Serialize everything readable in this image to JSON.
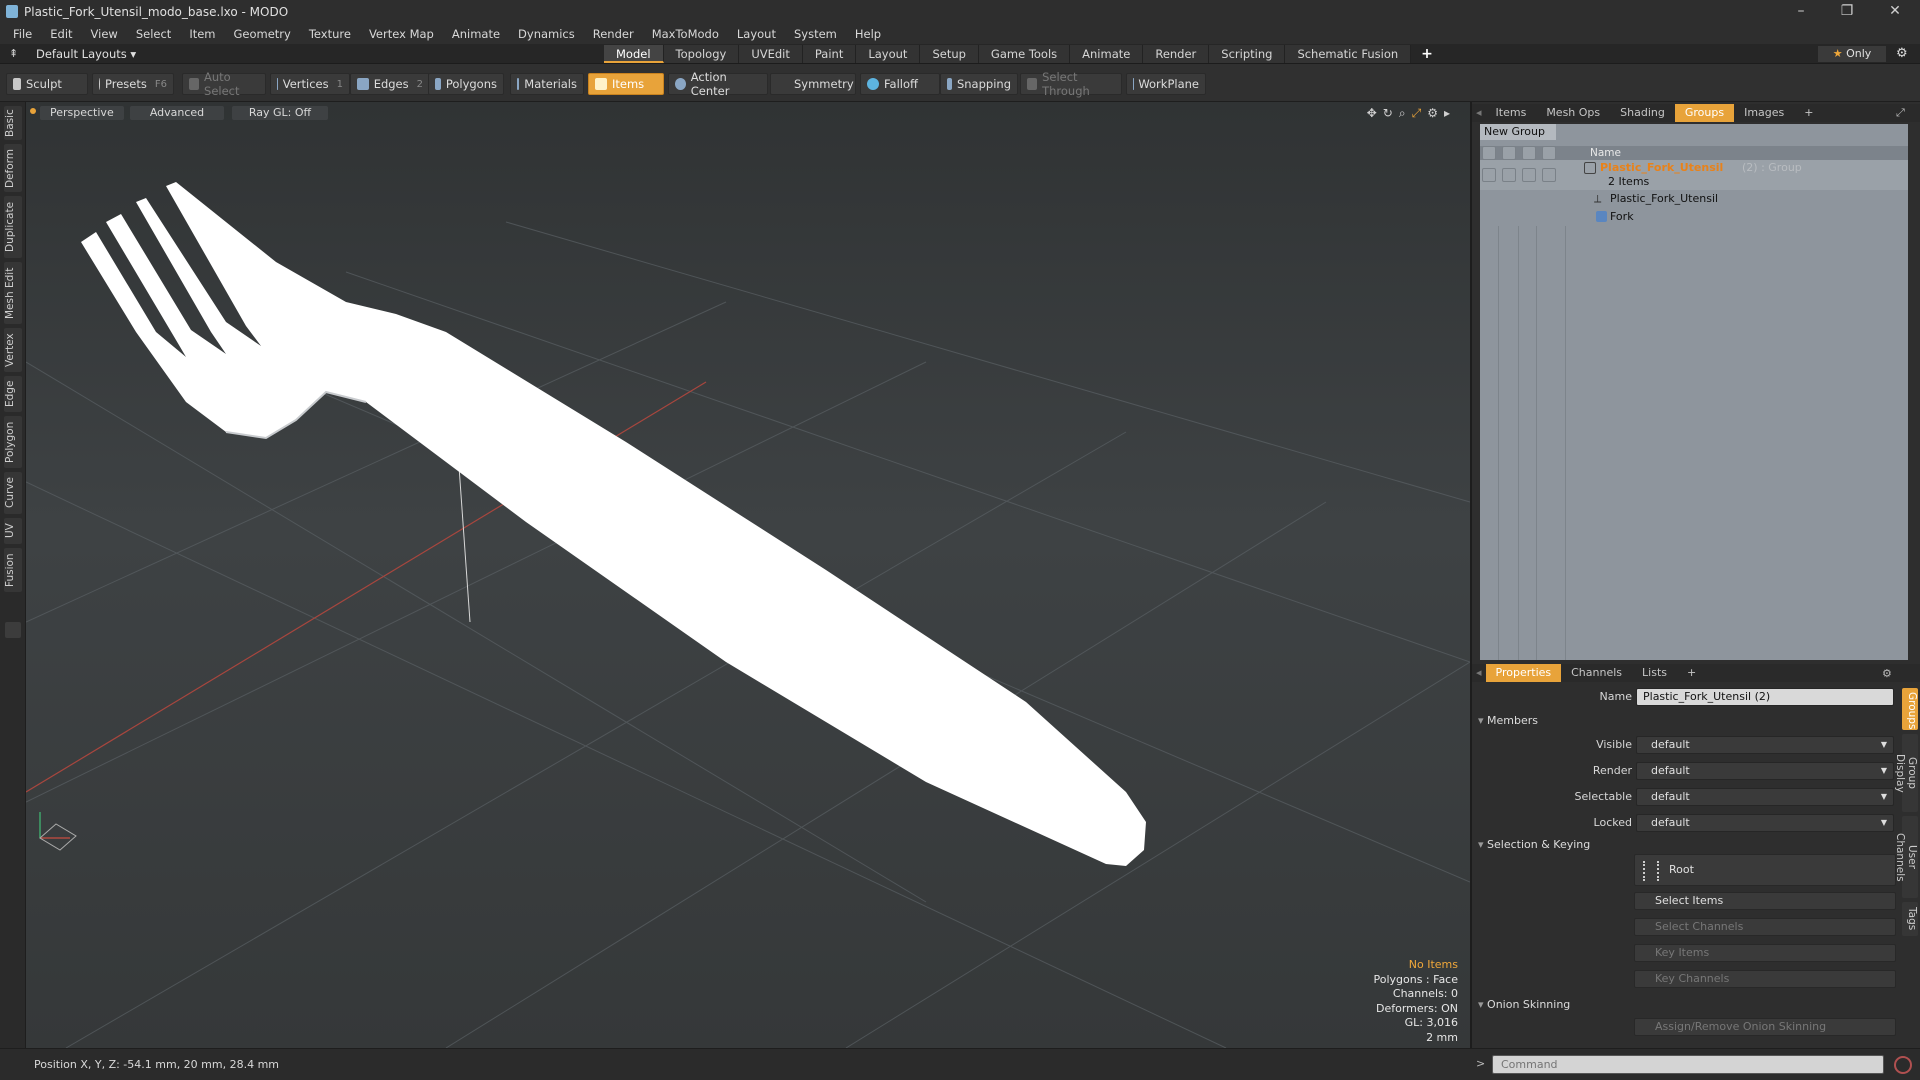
{
  "window": {
    "title": "Plastic_Fork_Utensil_modo_base.lxo - MODO",
    "min": "–",
    "max": "❐",
    "close": "✕"
  },
  "menu": [
    "File",
    "Edit",
    "View",
    "Select",
    "Item",
    "Geometry",
    "Texture",
    "Vertex Map",
    "Animate",
    "Dynamics",
    "Render",
    "MaxToModo",
    "Layout",
    "System",
    "Help"
  ],
  "layouts": {
    "label": "Default Layouts ▾",
    "tabs": [
      "Model",
      "Topology",
      "UVEdit",
      "Paint",
      "Layout",
      "Setup",
      "Game Tools",
      "Animate",
      "Render",
      "Scripting",
      "Schematic Fusion"
    ],
    "active": "Model",
    "plus": "+",
    "only": "Only",
    "only_star": "★"
  },
  "toolbar": {
    "sculpt": "Sculpt",
    "presets": "Presets",
    "presets_key": "F6",
    "auto_select": "Auto Select",
    "vertices": "Vertices",
    "vertices_key": "1",
    "edges": "Edges",
    "edges_key": "2",
    "polygons": "Polygons",
    "materials": "Materials",
    "items": "Items",
    "action_center": "Action Center",
    "symmetry": "Symmetry",
    "falloff": "Falloff",
    "snapping": "Snapping",
    "select_through": "Select Through",
    "workplane": "WorkPlane"
  },
  "left_tabs": [
    "Basic",
    "Deform",
    "Duplicate",
    "Mesh Edit",
    "Vertex",
    "Edge",
    "Polygon",
    "Curve",
    "UV",
    "Fusion"
  ],
  "viewport": {
    "perspective": "Perspective",
    "advanced": "Advanced",
    "raygl": "Ray GL: Off",
    "info": {
      "no_items": "No Items",
      "polygons": "Polygons : Face",
      "channels": "Channels: 0",
      "deformers": "Deformers: ON",
      "gl": "GL: 3,016",
      "scale": "2 mm"
    }
  },
  "panel_top": {
    "tabs": [
      "Items",
      "Mesh Ops",
      "Shading",
      "Groups",
      "Images"
    ],
    "active": "Groups",
    "plus": "+",
    "new_group": "New Group",
    "name_col": "Name",
    "group_name": "Plastic_Fork_Utensil",
    "group_suffix": "(2) : Group",
    "group_count": "2 Items",
    "children": [
      "Plastic_Fork_Utensil",
      "Fork"
    ]
  },
  "panel_bottom": {
    "tabs": [
      "Properties",
      "Channels",
      "Lists"
    ],
    "active": "Properties",
    "plus": "+",
    "name_label": "Name",
    "name_value": "Plastic_Fork_Utensil (2)",
    "members": "Members",
    "fields": [
      {
        "label": "Visible",
        "value": "default"
      },
      {
        "label": "Render",
        "value": "default"
      },
      {
        "label": "Selectable",
        "value": "default"
      },
      {
        "label": "Locked",
        "value": "default"
      }
    ],
    "sel_keying": "Selection & Keying",
    "root": "Root",
    "select_items": "Select Items",
    "select_channels": "Select Channels",
    "key_items": "Key Items",
    "key_channels": "Key Channels",
    "onion": "Onion Skinning",
    "assign_onion": "Assign/Remove Onion Skinning",
    "side_tabs": [
      "Groups",
      "Group Display",
      "User Channels",
      "Tags"
    ]
  },
  "status": {
    "position": "Position X, Y, Z:  -54.1 mm, 20 mm, 28.4 mm",
    "command_placeholder": "Command",
    "prompt": ">"
  },
  "colors": {
    "accent": "#e8a33a",
    "viewport_bg": "#3a3d3f",
    "groups_bg": "#8e959d"
  }
}
